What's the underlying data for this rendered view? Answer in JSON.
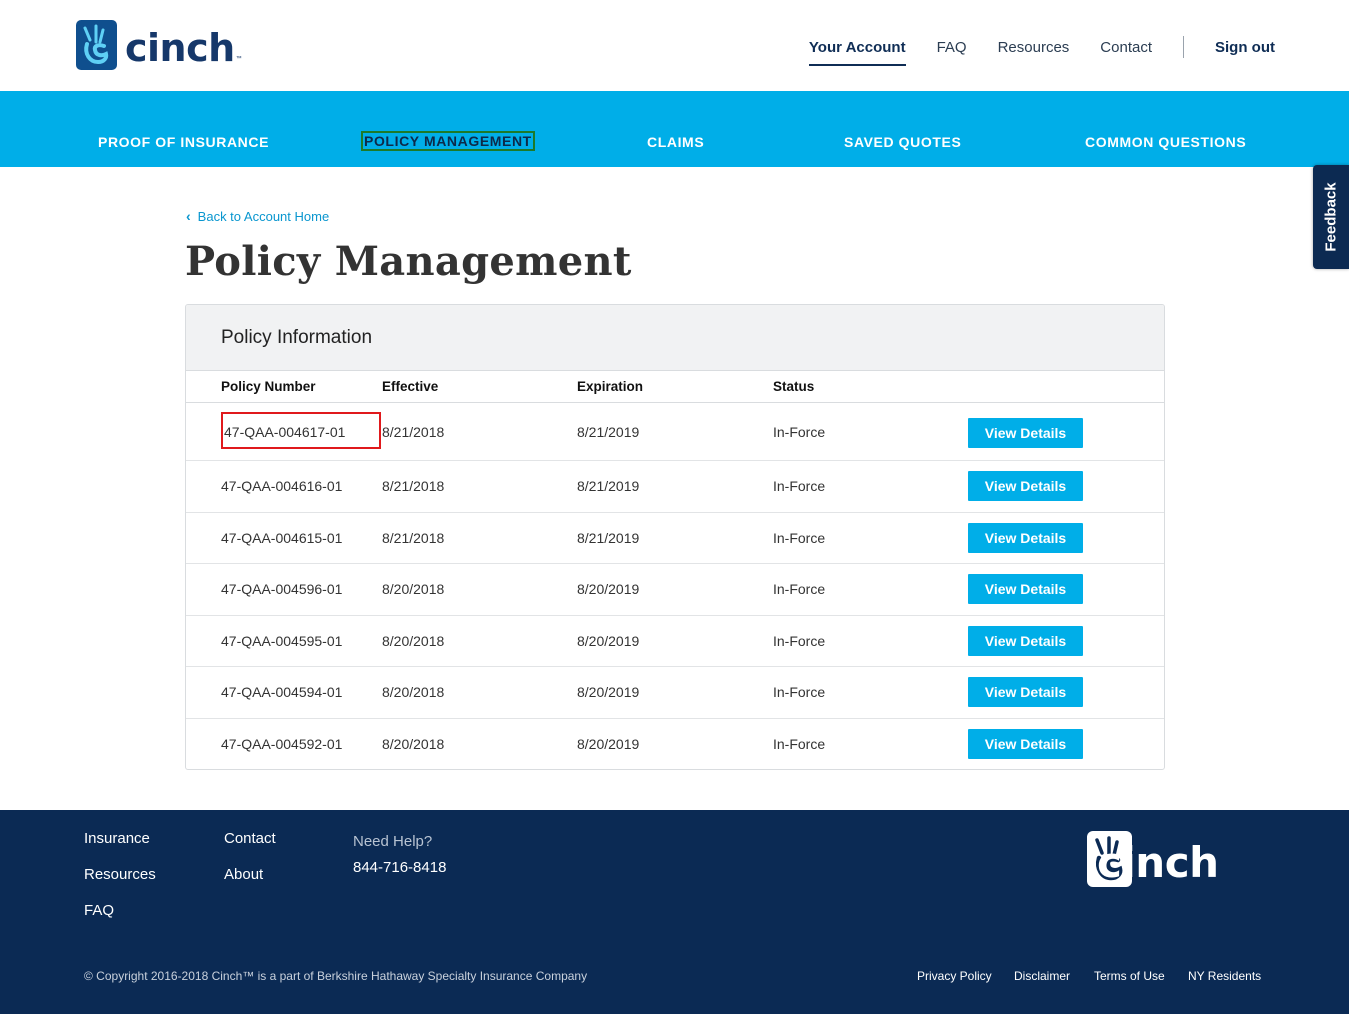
{
  "brand": {
    "name": "cinch",
    "tm": "™"
  },
  "topnav": {
    "your_account": "Your Account",
    "faq": "FAQ",
    "resources": "Resources",
    "contact": "Contact",
    "sign_out": "Sign out"
  },
  "subnav": {
    "proof": "PROOF OF INSURANCE",
    "policy": "POLICY MANAGEMENT",
    "claims": "CLAIMS",
    "saved": "SAVED QUOTES",
    "common": "COMMON QUESTIONS"
  },
  "feedback": "Feedback",
  "back_link": "Back to Account Home",
  "page_title": "Policy Management",
  "panel": {
    "title": "Policy Information",
    "columns": [
      "Policy Number",
      "Effective",
      "Expiration",
      "Status"
    ],
    "button_label": "View Details",
    "rows": [
      {
        "number": "47-QAA-004617-01",
        "effective": "8/21/2018",
        "expiration": "8/21/2019",
        "status": "In-Force"
      },
      {
        "number": "47-QAA-004616-01",
        "effective": "8/21/2018",
        "expiration": "8/21/2019",
        "status": "In-Force"
      },
      {
        "number": "47-QAA-004615-01",
        "effective": "8/21/2018",
        "expiration": "8/21/2019",
        "status": "In-Force"
      },
      {
        "number": "47-QAA-004596-01",
        "effective": "8/20/2018",
        "expiration": "8/20/2019",
        "status": "In-Force"
      },
      {
        "number": "47-QAA-004595-01",
        "effective": "8/20/2018",
        "expiration": "8/20/2019",
        "status": "In-Force"
      },
      {
        "number": "47-QAA-004594-01",
        "effective": "8/20/2018",
        "expiration": "8/20/2019",
        "status": "In-Force"
      },
      {
        "number": "47-QAA-004592-01",
        "effective": "8/20/2018",
        "expiration": "8/20/2019",
        "status": "In-Force"
      }
    ]
  },
  "footer": {
    "insurance": "Insurance",
    "resources": "Resources",
    "faq": "FAQ",
    "contact": "Contact",
    "about": "About",
    "need_help": "Need Help?",
    "phone": "844-716-8418",
    "copyright": "© Copyright 2016-2018 Cinch™ is a part of Berkshire Hathaway Specialty Insurance Company",
    "privacy": "Privacy Policy",
    "disclaimer": "Disclaimer",
    "terms": "Terms of Use",
    "ny": "NY Residents"
  },
  "colors": {
    "accent": "#00aee8",
    "navy": "#0b2a54",
    "highlight": "#e0191c",
    "focus": "#1d7a2a"
  },
  "icons": [
    "cinch-logo-icon",
    "chevron-left-icon"
  ]
}
